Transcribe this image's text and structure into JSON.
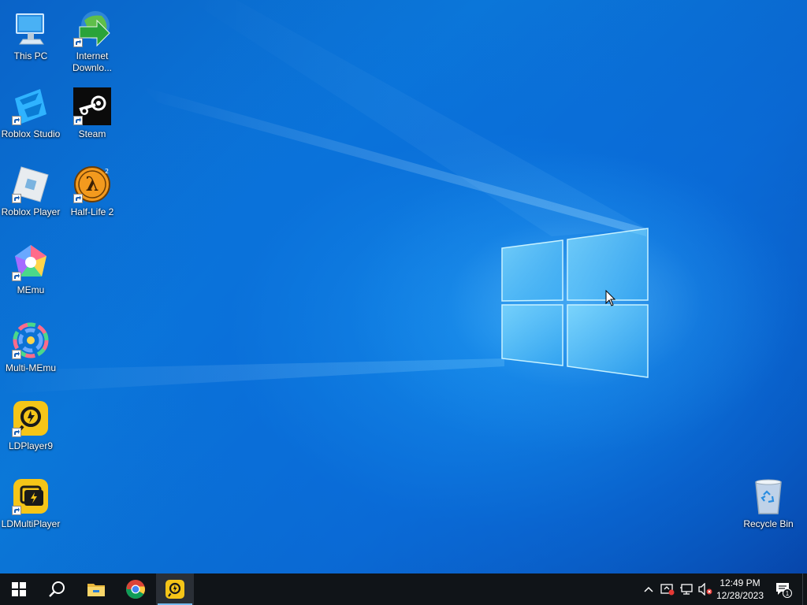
{
  "desktop": {
    "icons": [
      {
        "id": "this-pc",
        "label": "This PC"
      },
      {
        "id": "internet-download-manager",
        "label": "Internet Downlo..."
      },
      {
        "id": "roblox-studio",
        "label": "Roblox Studio"
      },
      {
        "id": "steam",
        "label": "Steam"
      },
      {
        "id": "roblox-player",
        "label": "Roblox Player"
      },
      {
        "id": "half-life-2",
        "label": "Half-Life 2"
      },
      {
        "id": "memu",
        "label": "MEmu"
      },
      {
        "id": "multi-memu",
        "label": "Multi-MEmu"
      },
      {
        "id": "ldplayer9",
        "label": "LDPlayer9"
      },
      {
        "id": "ldmultiplayer",
        "label": "LDMultiPlayer"
      },
      {
        "id": "recycle-bin",
        "label": "Recycle Bin"
      }
    ]
  },
  "taskbar": {
    "start_icon": "windows-logo-icon",
    "search_icon": "search-icon",
    "pinned": [
      "file-explorer-icon",
      "chrome-icon",
      "ldplayer-icon"
    ],
    "tray": {
      "icons": [
        "chevron-up-icon",
        "security-warning-icon",
        "network-icon",
        "volume-muted-icon"
      ],
      "time": "12:49 PM",
      "date": "12/28/2023",
      "notification_count": "1"
    }
  },
  "colors": {
    "desktop_blue": "#0b78d8",
    "taskbar": "#101418",
    "ld_yellow": "#f5c518"
  }
}
